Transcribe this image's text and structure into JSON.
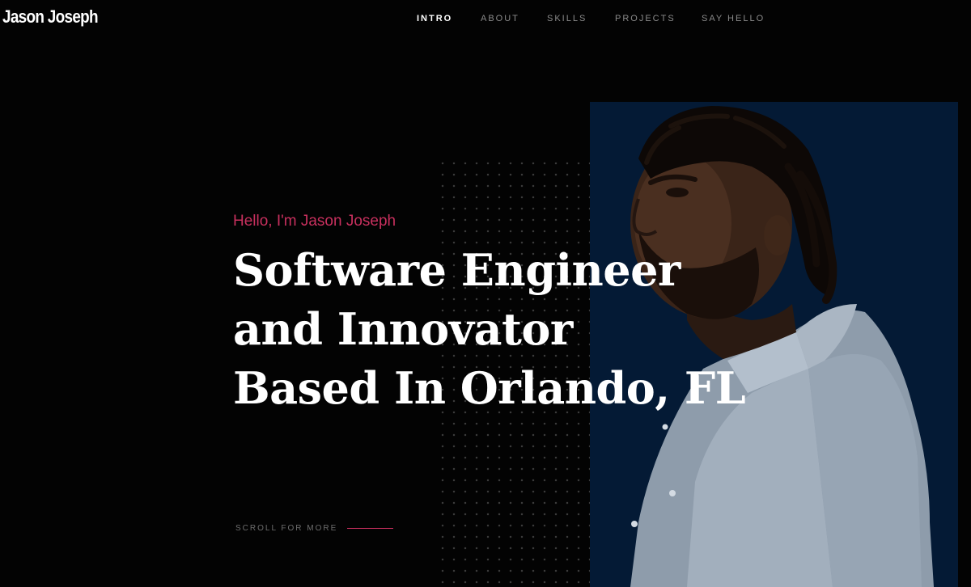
{
  "brand": {
    "name": "Jason Joseph"
  },
  "nav": {
    "items": [
      {
        "label": "INTRO",
        "active": true
      },
      {
        "label": "ABOUT",
        "active": false
      },
      {
        "label": "SKILLS",
        "active": false
      },
      {
        "label": "PROJECTS",
        "active": false
      },
      {
        "label": "SAY HELLO",
        "active": false
      }
    ]
  },
  "hero": {
    "greeting": "Hello, I'm Jason Joseph",
    "headline_lines": [
      "Software Engineer",
      "and Innovator",
      "Based In Orlando, FL"
    ],
    "scroll_label": "SCROLL FOR MORE"
  },
  "colors": {
    "background": "#030303",
    "accent": "#c8305e",
    "portrait_panel": "#041a35",
    "nav_inactive": "#8a8a8a",
    "nav_active": "#ffffff"
  }
}
